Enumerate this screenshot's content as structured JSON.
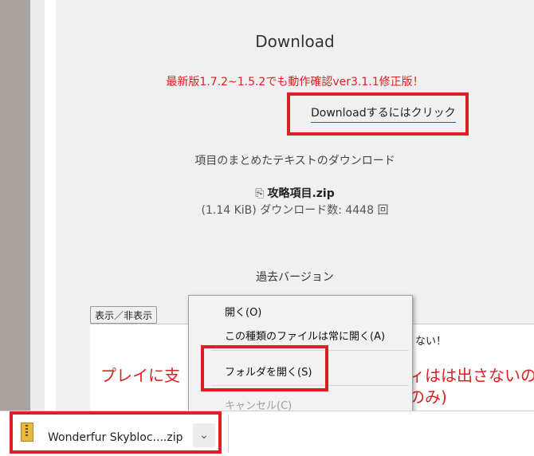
{
  "page": {
    "title": "Download",
    "notice": "最新版1.7.2~1.5.2でも動作確認ver3.1.1修正版！",
    "download_link": "Downloadするにはクリック",
    "summary": "項目のまとめたテキストのダウンロード",
    "file": {
      "icon": "paperclip-icon",
      "name": "攻略項目.zip",
      "meta": "(1.14 KiB) ダウンロード数: 4448 回"
    },
    "past_versions": "過去バージョン",
    "toggle_button": "表示／非表示",
    "info_box": {
      "left_text": "プレイに支",
      "right_top": "ない！",
      "right_line1": "ィはは出さないの",
      "right_line2": "のみ)"
    }
  },
  "context_menu": {
    "items": [
      {
        "label": "開く(O)",
        "disabled": false
      },
      {
        "label": "この種類のファイルは常に開く(A)",
        "disabled": false
      },
      {
        "label": "フォルダを開く(S)",
        "disabled": false
      },
      {
        "label": "キャンセル(C)",
        "disabled": true
      }
    ]
  },
  "download_bar": {
    "file_label": "Wonderfur Skybloc....zip",
    "icon": "zip-file-icon",
    "menu_icon": "chevron-down-icon"
  },
  "colors": {
    "highlight": "#dd1f26",
    "notice_red": "#e02020"
  }
}
